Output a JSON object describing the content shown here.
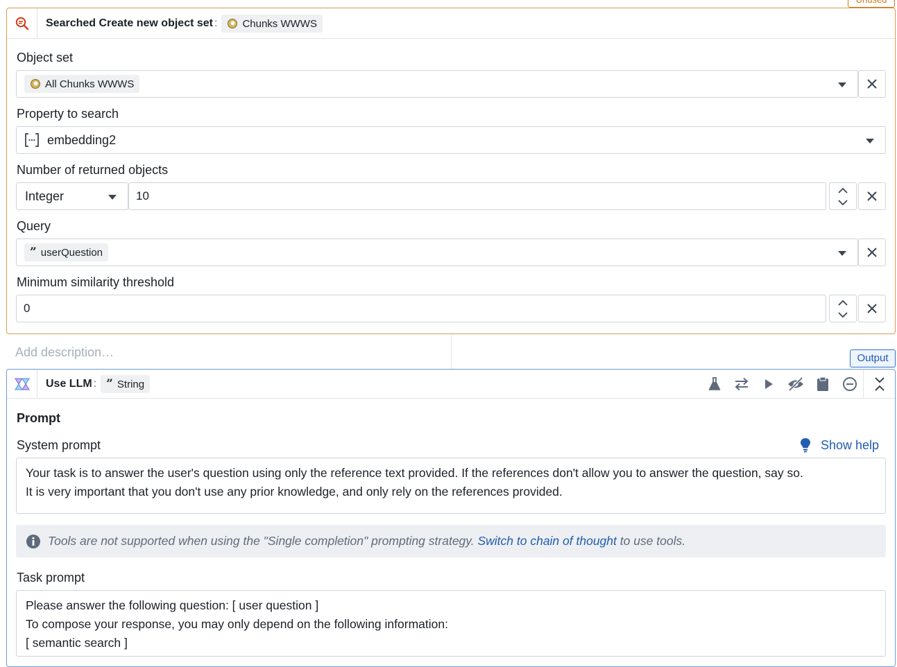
{
  "top_tag": {
    "label": "Unused"
  },
  "search_card": {
    "title": "Searched Create new object set",
    "type_chip": "Chunks WWWS",
    "fields": {
      "object_set": {
        "label": "Object set",
        "value": "All Chunks WWWS"
      },
      "property": {
        "label": "Property to search",
        "value": "embedding2"
      },
      "num_objects": {
        "label": "Number of returned objects",
        "type_value": "Integer",
        "value": "10"
      },
      "query": {
        "label": "Query",
        "value": "userQuestion"
      },
      "min_similarity": {
        "label": "Minimum similarity threshold",
        "value": "0"
      }
    }
  },
  "description": {
    "placeholder": "Add description…"
  },
  "output_tag": {
    "label": "Output"
  },
  "llm_card": {
    "title": "Use LLM",
    "type_chip": "String",
    "toolbar_icons": [
      "flask-icon",
      "swap-icon",
      "play-icon",
      "eye-off-icon",
      "clipboard-icon",
      "minus-circle-icon"
    ],
    "prompt_section": "Prompt",
    "system_prompt": {
      "label": "System prompt",
      "help": "Show help",
      "line1": "Your task is to answer the user's question using only the reference text provided. If the references don't allow you to answer the question, say so.",
      "line2": "It is very important that you don't use any prior knowledge, and only rely on the references provided."
    },
    "info": {
      "before": "Tools are not supported when using the \"Single completion\" prompting strategy.",
      "link": "Switch to chain of thought",
      "after": "to use tools."
    },
    "task_prompt": {
      "label": "Task prompt",
      "line1": "Please answer the following question: [ user question ]",
      "line2": "To compose your response, you may only depend on the following information:",
      "line3": "[ semantic search ]"
    }
  },
  "colors": {
    "search_border": "#d99a4e",
    "llm_border": "#6e9ad6",
    "link": "#215db0"
  }
}
